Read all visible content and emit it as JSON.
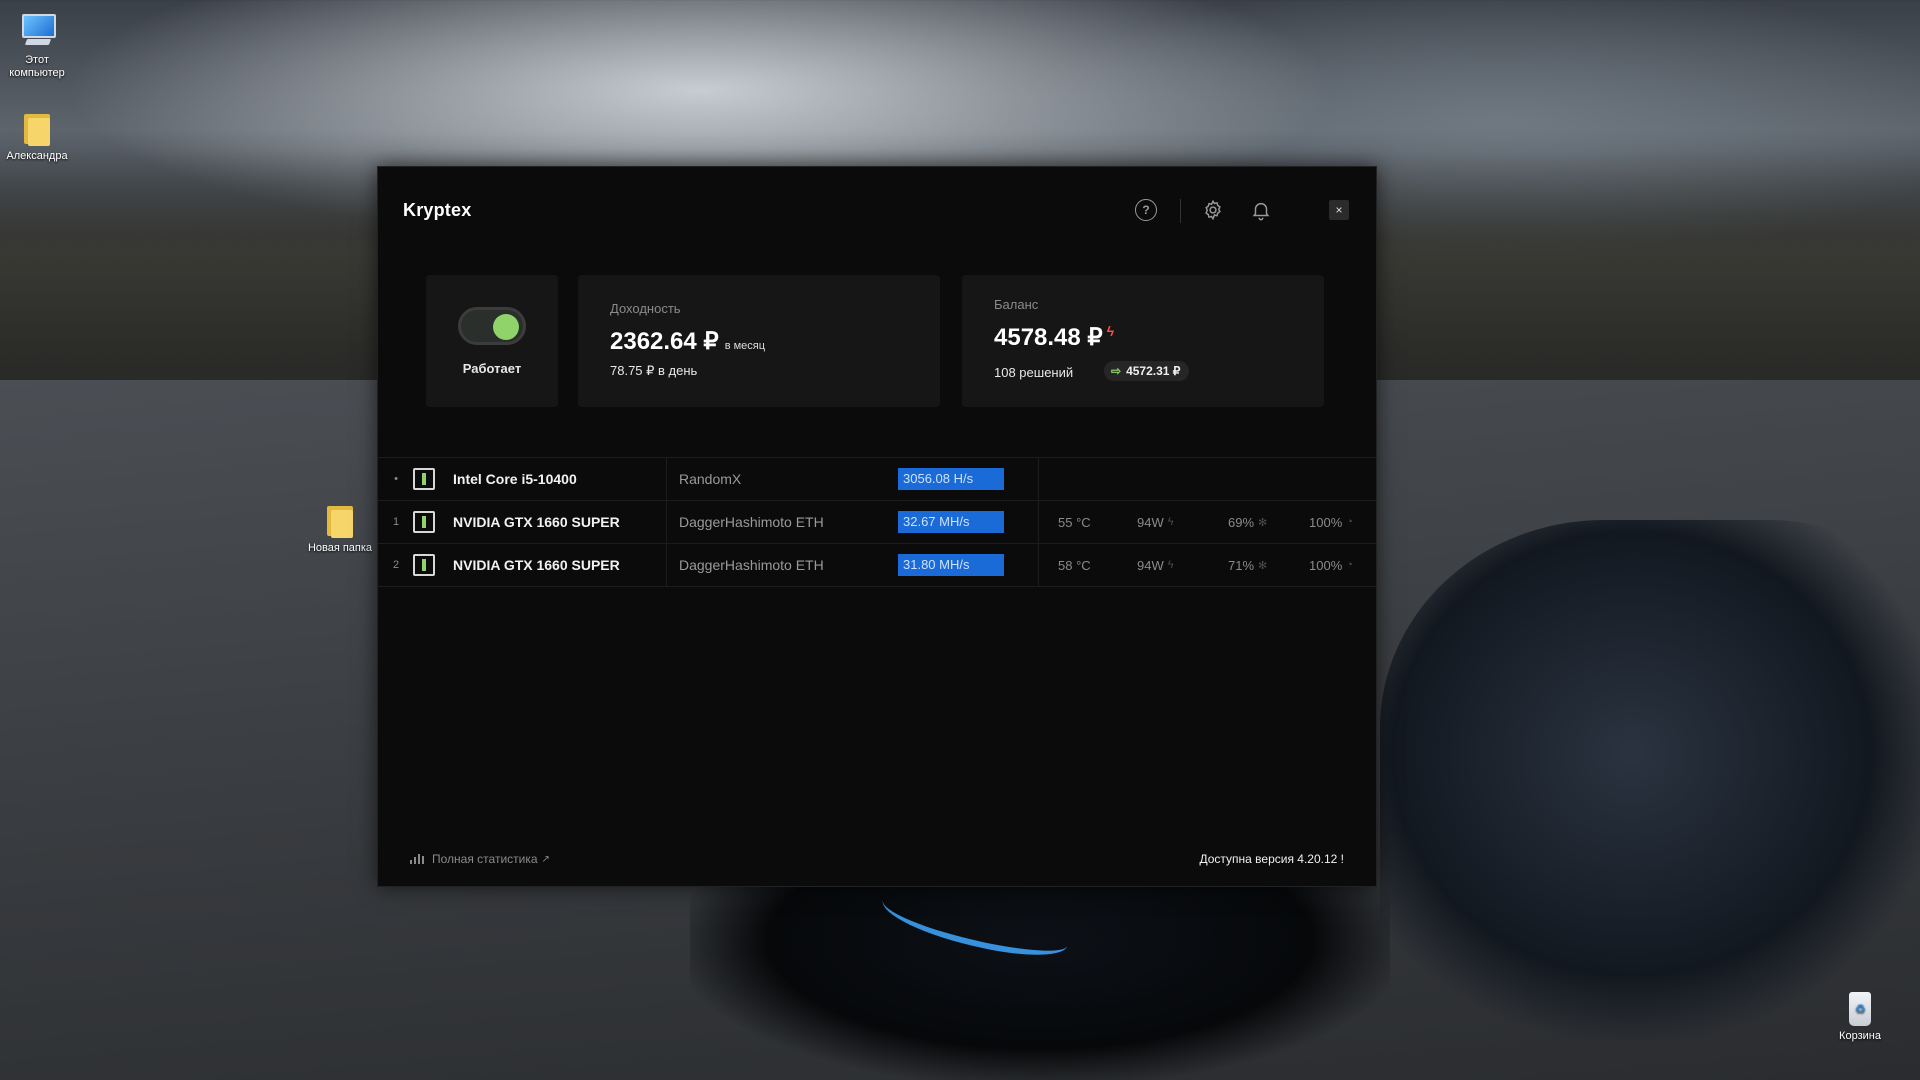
{
  "desktop": {
    "icons": [
      {
        "label": "Этот компьютер"
      },
      {
        "label": "Александра"
      },
      {
        "label": "Новая папка"
      },
      {
        "label": "Корзина"
      }
    ]
  },
  "app": {
    "title": "Kryptex",
    "status": {
      "label": "Работает",
      "running": true
    },
    "income": {
      "label": "Доходность",
      "monthly": "2362.64 ₽",
      "monthly_unit": "в месяц",
      "daily": "78.75 ₽ в день"
    },
    "balance": {
      "label": "Баланс",
      "value": "4578.48 ₽",
      "solutions": "108 решений",
      "withdraw": "4572.31 ₽"
    },
    "devices": [
      {
        "index": "•",
        "name": "Intel Core i5-10400",
        "algo": "RandomX",
        "hashrate": "3056.08 H/s",
        "temp": "",
        "power": "",
        "fan": "",
        "load": ""
      },
      {
        "index": "1",
        "name": "NVIDIA GTX 1660 SUPER",
        "algo": "DaggerHashimoto ETH",
        "hashrate": "32.67 MH/s",
        "temp": "55 °C",
        "power": "94W",
        "fan": "69%",
        "load": "100%"
      },
      {
        "index": "2",
        "name": "NVIDIA GTX 1660 SUPER",
        "algo": "DaggerHashimoto ETH",
        "hashrate": "31.80 MH/s",
        "temp": "58 °C",
        "power": "94W",
        "fan": "71%",
        "load": "100%"
      }
    ],
    "footer": {
      "stats_link": "Полная статистика",
      "update": "Доступна версия 4.20.12 !"
    },
    "colors": {
      "accent_green": "#8fd36a",
      "hash_blue": "#1a6ad8",
      "bolt_red": "#ff4a4a"
    }
  }
}
